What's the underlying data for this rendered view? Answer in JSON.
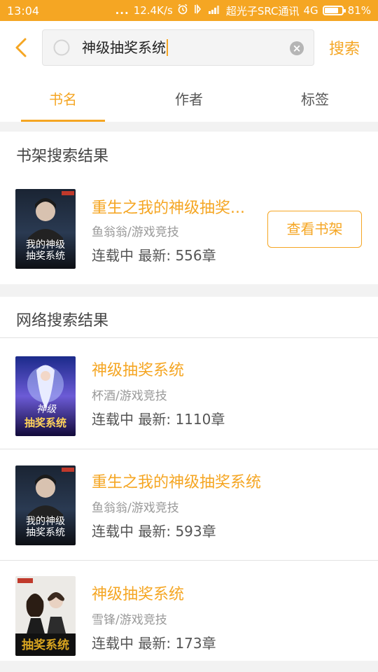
{
  "status_bar": {
    "time": "13:04",
    "dots": "...",
    "net_speed": "12.4K/s",
    "carrier": "超光子SRC通讯",
    "network": "4G",
    "battery": "81%",
    "battery_level": 0.81
  },
  "search": {
    "query": "神级抽奖系统",
    "button_label": "搜索"
  },
  "tabs": [
    {
      "label": "书名",
      "active": true
    },
    {
      "label": "作者",
      "active": false
    },
    {
      "label": "标签",
      "active": false
    }
  ],
  "shelf_results": {
    "title": "书架搜索结果",
    "items": [
      {
        "title": "重生之我的神级抽奖...",
        "author_genre": "鱼翁翁/游戏竞技",
        "status": "连载中 最新: 556章",
        "button_label": "查看书架",
        "cover": "cover-1"
      }
    ]
  },
  "web_results": {
    "title": "网络搜索结果",
    "items": [
      {
        "title": "神级抽奖系统",
        "author_genre": "杯酒/游戏竞技",
        "status": "连载中 最新: 1110章",
        "cover": "cover-2"
      },
      {
        "title": "重生之我的神级抽奖系统",
        "author_genre": "鱼翁翁/游戏竞技",
        "status": "连载中 最新: 593章",
        "cover": "cover-1"
      },
      {
        "title": "神级抽奖系统",
        "author_genre": "雪锋/游戏竞技",
        "status": "连载中 最新: 173章",
        "cover": "cover-3"
      }
    ]
  },
  "colors": {
    "accent": "#f5a623",
    "background": "#f2f2f2"
  },
  "icons": {
    "back": "chevron-left-icon",
    "search": "search-icon",
    "clear": "clear-icon",
    "alarm": "alarm-icon",
    "vibrate": "vibrate-icon",
    "signal": "signal-icon",
    "battery": "battery-icon"
  }
}
